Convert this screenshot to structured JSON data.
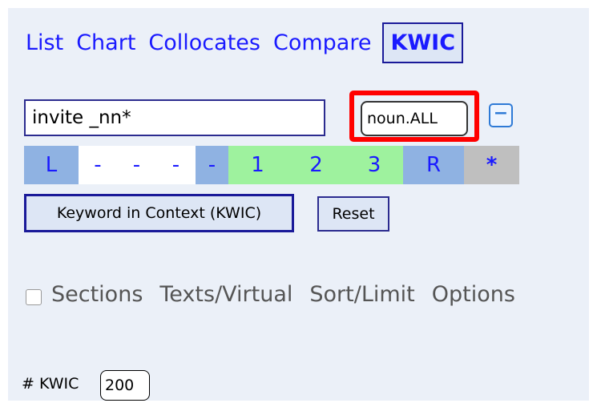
{
  "nav": {
    "items": [
      "List",
      "Chart",
      "Collocates",
      "Compare",
      "KWIC"
    ],
    "active": "KWIC"
  },
  "search": {
    "query": "invite _nn*",
    "pos_filter": "noun.ALL",
    "remove_icon": "minus-icon"
  },
  "slots": [
    "L",
    "-",
    "-",
    "-",
    "-",
    "1",
    "2",
    "3",
    "R",
    "*"
  ],
  "buttons": {
    "kwic": "Keyword in Context (KWIC)",
    "reset": "Reset"
  },
  "tabs": {
    "sections": "Sections",
    "texts": "Texts/Virtual",
    "sort": "Sort/Limit",
    "options": "Options"
  },
  "count": {
    "label": "# KWIC",
    "value": "200"
  },
  "colors": {
    "link": "#1a1aff",
    "highlight": "#ff0000",
    "slot_blue": "#8fb2e2",
    "slot_green": "#9ef29e",
    "slot_gray": "#bfbfbf"
  }
}
